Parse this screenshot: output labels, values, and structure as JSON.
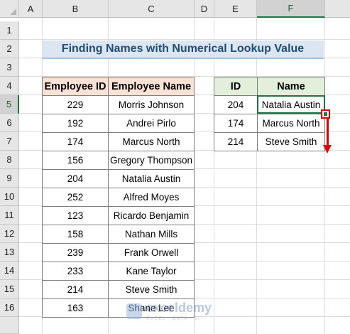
{
  "columns": [
    "A",
    "B",
    "C",
    "D",
    "E",
    "F"
  ],
  "rows": [
    "1",
    "2",
    "3",
    "4",
    "5",
    "6",
    "7",
    "8",
    "9",
    "10",
    "11",
    "12",
    "13",
    "14",
    "15",
    "16"
  ],
  "selected_column": "F",
  "selected_row": "5",
  "title": "Finding Names with Numerical Lookup Value",
  "main_table": {
    "headers": [
      "Employee ID",
      "Employee Name"
    ],
    "rows": [
      [
        "229",
        "Morris Johnson"
      ],
      [
        "192",
        "Andrei Pirlo"
      ],
      [
        "174",
        "Marcus North"
      ],
      [
        "156",
        "Gregory Thompson"
      ],
      [
        "204",
        "Natalia Austin"
      ],
      [
        "252",
        "Alfred Moyes"
      ],
      [
        "123",
        "Ricardo Benjamin"
      ],
      [
        "158",
        "Nathan Mills"
      ],
      [
        "239",
        "Frank Orwell"
      ],
      [
        "233",
        "Kane Taylor"
      ],
      [
        "214",
        "Steve Smith"
      ],
      [
        "163",
        "Shane Lee"
      ]
    ]
  },
  "lookup_table": {
    "headers": [
      "ID",
      "Name"
    ],
    "rows": [
      [
        "204",
        "Natalia Austin"
      ],
      [
        "174",
        "Marcus North"
      ],
      [
        "214",
        "Steve Smith"
      ]
    ]
  },
  "watermark": {
    "name": "exceldemy",
    "tagline": "EXCEL · DATA · BI"
  },
  "colors": {
    "selection": "#217346",
    "arrow": "#e00000",
    "title_bg": "#dce6f2",
    "header_main": "#fbe2d5",
    "header_lookup": "#e2efda"
  }
}
